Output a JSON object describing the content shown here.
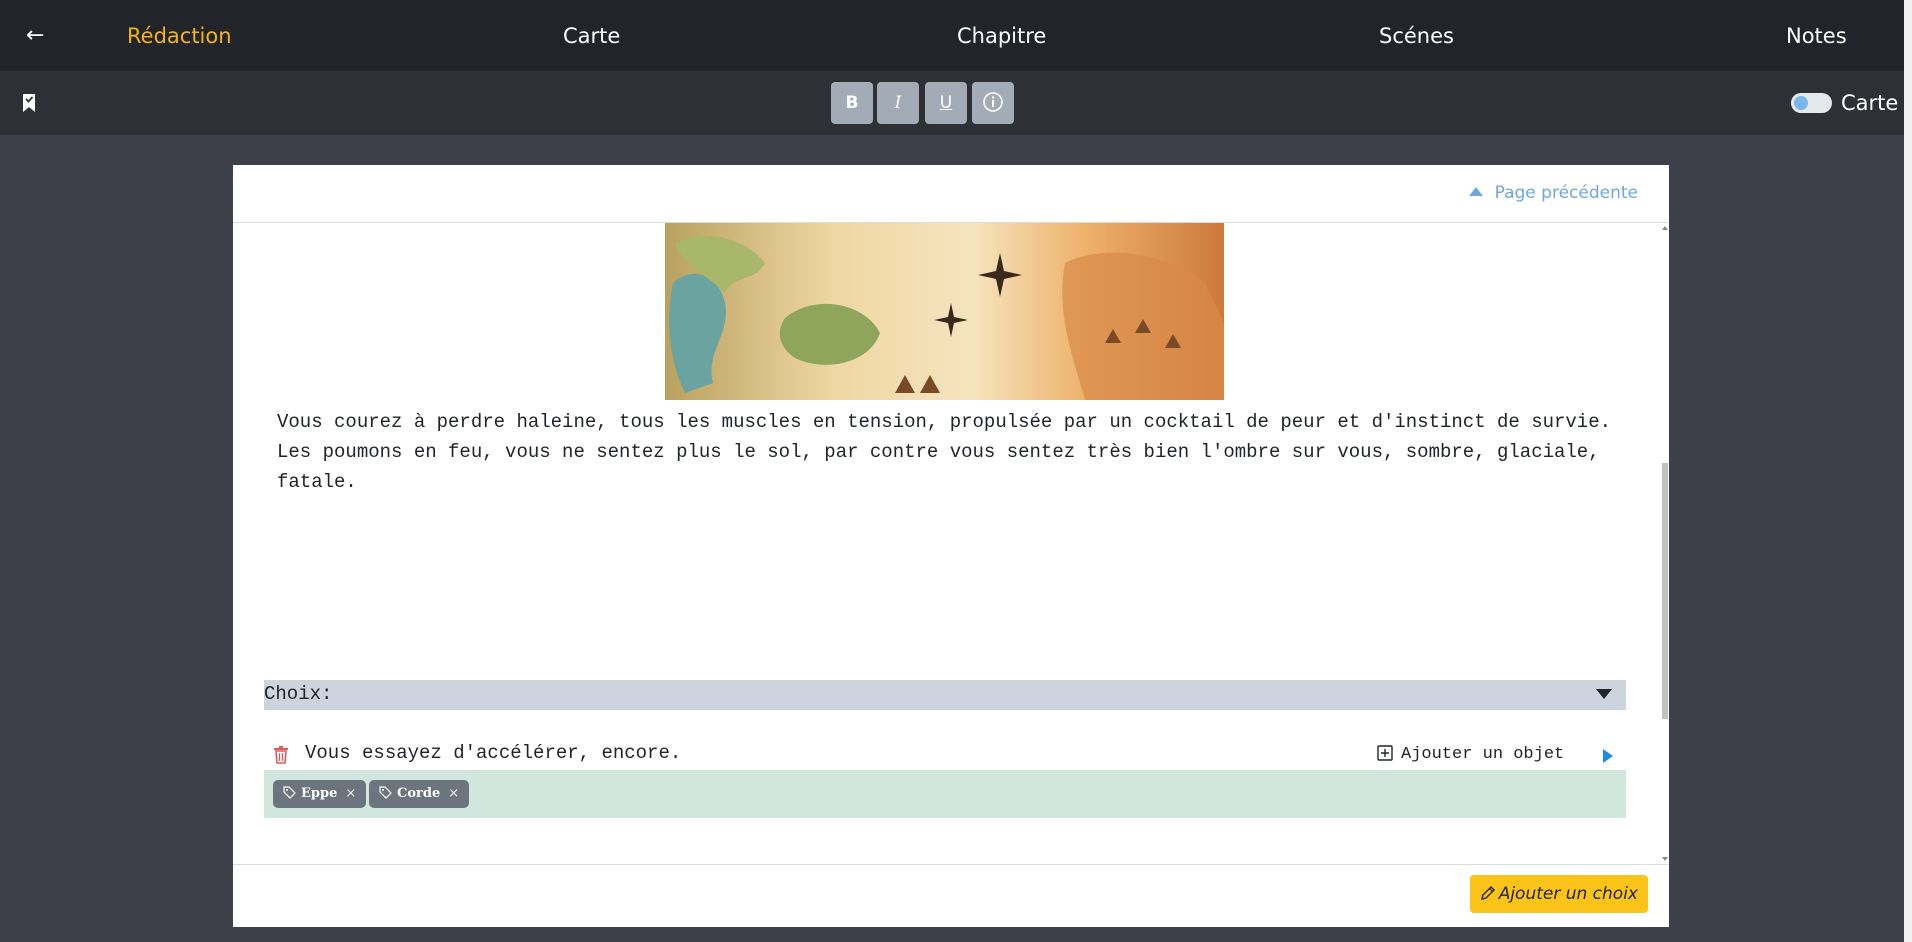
{
  "nav": {
    "back": "←",
    "items": [
      "Rédaction",
      "Carte",
      "Chapitre",
      "Scénes",
      "Notes"
    ],
    "active_color": "#f4b31b"
  },
  "toolbar": {
    "bold": "B",
    "italic": "I",
    "underline": "U",
    "info": "i",
    "toggle_label": "Carte",
    "toggle_on": false
  },
  "editor": {
    "prev_page": "Page précédente",
    "story_text": "Vous courez à perdre haleine, tous les muscles en tension, propulsée par un cocktail de peur et d'instinct de survie. Les poumons en feu, vous ne sentez plus le sol, par contre vous sentez très bien l'ombre sur vous, sombre, glaciale, fatale.",
    "choices_header": "Choix:",
    "choice": {
      "text": "Vous essayez d'accélérer, encore.",
      "add_object": "Ajouter un objet",
      "tags": [
        "Eppe",
        "Corde"
      ]
    },
    "add_choice": "Ajouter un choix"
  },
  "colors": {
    "accent": "#f4b31b",
    "link": "#6fa7de",
    "tag_bg": "#6c757d",
    "tags_bar": "#d1e7dd",
    "add_choice": "#fcc419",
    "delete": "#e05a5a"
  }
}
